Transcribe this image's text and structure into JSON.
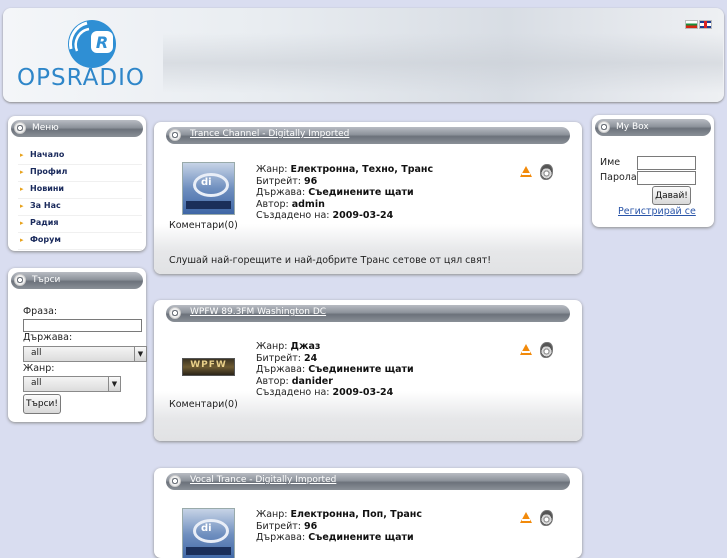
{
  "header": {
    "logo_text": "OPSRADIO",
    "languages": [
      "bg-flag-icon",
      "en-flag-icon"
    ]
  },
  "menu": {
    "title": "Меню",
    "items": [
      {
        "label": "Начало"
      },
      {
        "label": "Профил"
      },
      {
        "label": "Новини"
      },
      {
        "label": "За Нас"
      },
      {
        "label": "Радия"
      },
      {
        "label": "Форум"
      }
    ]
  },
  "search": {
    "title": "Търси",
    "phrase_label": "Фраза:",
    "phrase_value": "",
    "country_label": "Държава:",
    "country_value": "all",
    "genre_label": "Жанр:",
    "genre_value": "all",
    "submit_label": "Търси!"
  },
  "mybox": {
    "title": "My Box",
    "username_label": "Име",
    "password_label": "Парола",
    "submit_label": "Давай!",
    "register_label": "Регистрирай се"
  },
  "labels": {
    "genre": "Жанр:",
    "bitrate": "Битрейт:",
    "country": "Държава:",
    "author": "Автор:",
    "created": "Създадено на:"
  },
  "stations": [
    {
      "title": "Trance Channel - Digitally Imported",
      "genre": "Електронна, Техно, Транс",
      "bitrate": "96",
      "country": "Съединените щати",
      "author": "admin",
      "created": "2009-03-24",
      "comments": "Коментари(0)",
      "description": "Слушай най-горещите и най-добрите Транс сетове от цял свят!",
      "logo": "di-logo"
    },
    {
      "title": "WPFW 89.3FM Washington DC",
      "genre": "Джаз",
      "bitrate": "24",
      "country": "Съединените щати",
      "author": "danider",
      "created": "2009-03-24",
      "comments": "Коментари(0)",
      "description": "",
      "logo": "wpfw-logo",
      "logo_text": "WPFW"
    },
    {
      "title": "Vocal Trance - Digitally Imported",
      "genre": "Електронна, Поп, Транс",
      "bitrate": "96",
      "country": "Съединените щати",
      "logo": "di-logo"
    }
  ],
  "player_icons": [
    "vlc-icon",
    "windows-media-icon"
  ]
}
